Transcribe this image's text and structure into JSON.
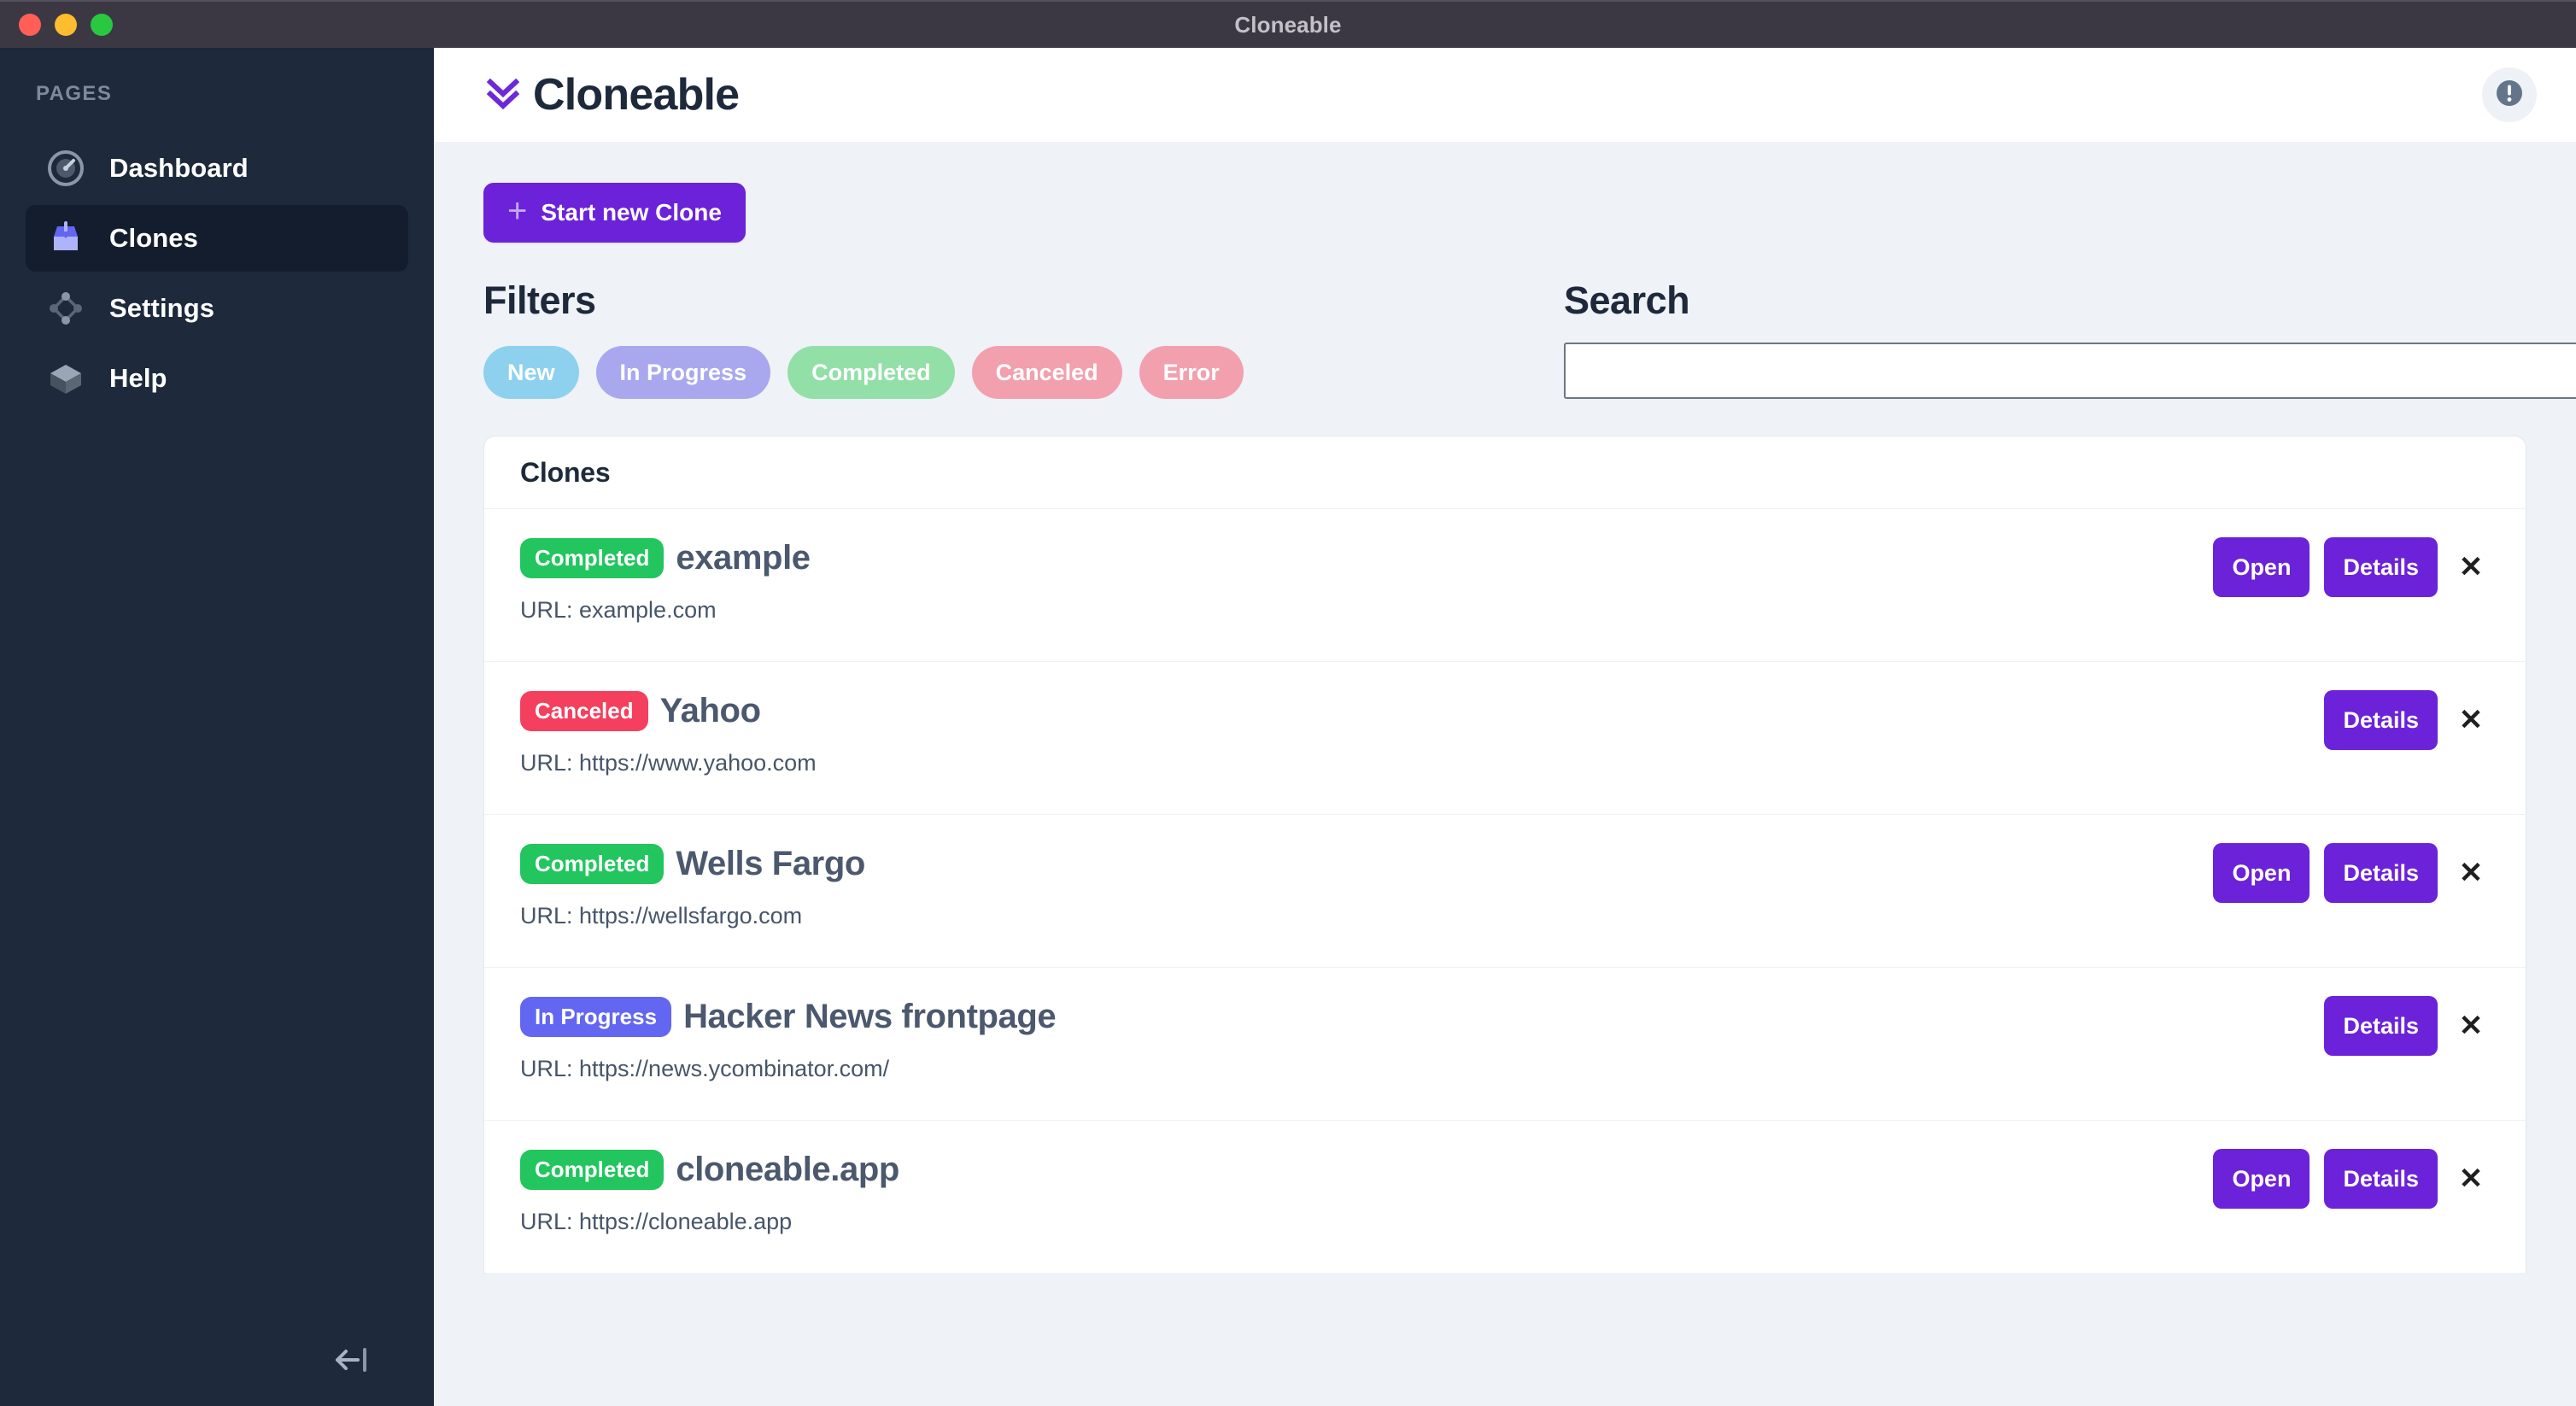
{
  "window": {
    "title": "Cloneable"
  },
  "sidebar": {
    "section_label": "PAGES",
    "items": [
      {
        "label": "Dashboard",
        "icon": "gauge-icon",
        "active": false
      },
      {
        "label": "Clones",
        "icon": "inbox-download-icon",
        "active": true
      },
      {
        "label": "Settings",
        "icon": "node-graph-icon",
        "active": false
      },
      {
        "label": "Help",
        "icon": "cube-icon",
        "active": false
      }
    ],
    "collapse_icon": "arrow-left-bar-icon"
  },
  "appbar": {
    "brand": "Cloneable",
    "brand_mark_icon": "double-chevron-down-icon",
    "info_icon": "info-circle-icon"
  },
  "toolbar": {
    "start_new_clone_label": "Start new Clone",
    "plus_icon": "plus-icon"
  },
  "filters": {
    "heading": "Filters",
    "pills": [
      {
        "label": "New",
        "color": "#8ed1ef"
      },
      {
        "label": "In Progress",
        "color": "#a9a8ee"
      },
      {
        "label": "Completed",
        "color": "#92dfa8"
      },
      {
        "label": "Canceled",
        "color": "#f2a0ae"
      },
      {
        "label": "Error",
        "color": "#f2a0ae"
      }
    ]
  },
  "search": {
    "heading": "Search",
    "value": "",
    "placeholder": ""
  },
  "clones_card": {
    "title": "Clones",
    "open_label": "Open",
    "details_label": "Details",
    "close_icon": "close-x-icon",
    "url_prefix": "URL: ",
    "status_colors": {
      "Completed": "#22c55e",
      "Canceled": "#f43f5e",
      "In Progress": "#6366f1"
    },
    "rows": [
      {
        "status": "Completed",
        "name": "example",
        "url": "URL: example.com",
        "has_open": true
      },
      {
        "status": "Canceled",
        "name": "Yahoo",
        "url": "URL: https://www.yahoo.com",
        "has_open": false
      },
      {
        "status": "Completed",
        "name": "Wells Fargo",
        "url": "URL: https://wellsfargo.com",
        "has_open": true
      },
      {
        "status": "In Progress",
        "name": "Hacker News frontpage",
        "url": "URL: https://news.ycombinator.com/",
        "has_open": false
      },
      {
        "status": "Completed",
        "name": "cloneable.app",
        "url": "URL: https://cloneable.app",
        "has_open": true
      }
    ]
  },
  "colors": {
    "accent_purple": "#6b22d8",
    "sidebar_bg": "#1e293b",
    "sidebar_active_bg": "#131d2e",
    "app_bg": "#eff2f6",
    "titlebar_bg": "#3b3843"
  }
}
